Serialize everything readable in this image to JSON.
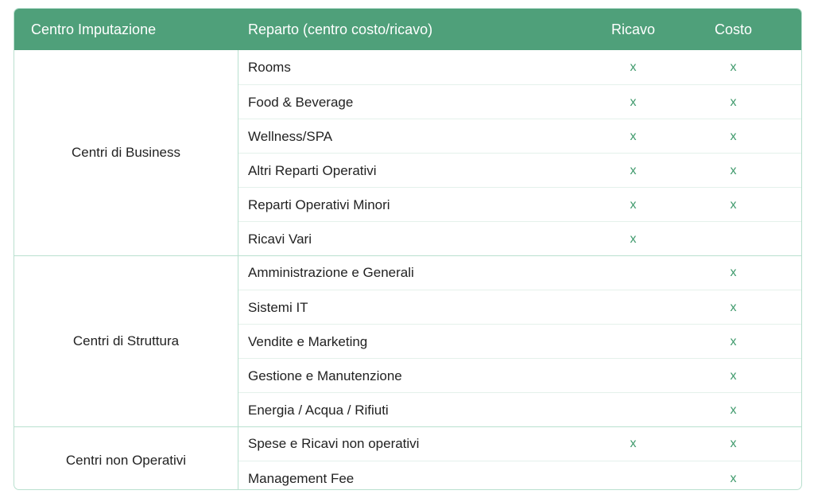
{
  "header": {
    "centro": "Centro Imputazione",
    "reparto": "Reparto (centro costo/ricavo)",
    "ricavo": "Ricavo",
    "costo": "Costo"
  },
  "groups": [
    {
      "name": "Centri di Business",
      "rows": [
        {
          "reparto": "Rooms",
          "ricavo": "x",
          "costo": "x"
        },
        {
          "reparto": "Food & Beverage",
          "ricavo": "x",
          "costo": "x"
        },
        {
          "reparto": "Wellness/SPA",
          "ricavo": "x",
          "costo": "x"
        },
        {
          "reparto": "Altri Reparti Operativi",
          "ricavo": "x",
          "costo": "x"
        },
        {
          "reparto": "Reparti Operativi Minori",
          "ricavo": "x",
          "costo": "x"
        },
        {
          "reparto": "Ricavi Vari",
          "ricavo": "x",
          "costo": ""
        }
      ]
    },
    {
      "name": "Centri di Struttura",
      "rows": [
        {
          "reparto": "Amministrazione e Generali",
          "ricavo": "",
          "costo": "x"
        },
        {
          "reparto": "Sistemi IT",
          "ricavo": "",
          "costo": "x"
        },
        {
          "reparto": "Vendite e Marketing",
          "ricavo": "",
          "costo": "x"
        },
        {
          "reparto": "Gestione e Manutenzione",
          "ricavo": "",
          "costo": "x"
        },
        {
          "reparto": "Energia / Acqua / Rifiuti",
          "ricavo": "",
          "costo": "x"
        }
      ]
    },
    {
      "name": "Centri non Operativi",
      "rows": [
        {
          "reparto": "Spese e Ricavi non operativi",
          "ricavo": "x",
          "costo": "x"
        },
        {
          "reparto": "Management Fee",
          "ricavo": "",
          "costo": "x"
        }
      ]
    }
  ],
  "colors": {
    "header_bg": "#4fa07a",
    "mark": "#3f9a6c",
    "border": "#b9e0cf"
  }
}
